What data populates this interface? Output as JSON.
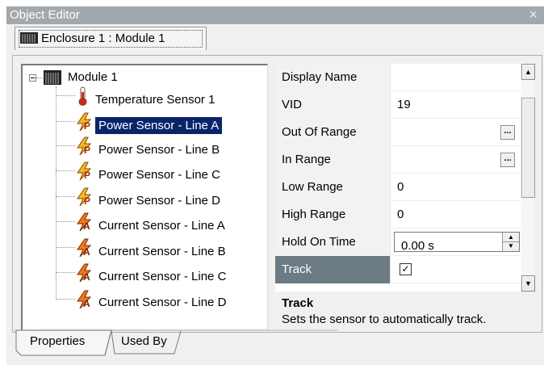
{
  "window": {
    "title": "Object Editor",
    "close_glyph": "×"
  },
  "document_tab": {
    "label": "Enclosure 1 : Module 1",
    "icon": "rack-module-icon"
  },
  "tree": {
    "root": {
      "label": "Module 1",
      "icon": "rack-module-icon",
      "expanded": true
    },
    "items": [
      {
        "label": "Temperature Sensor 1",
        "icon": "thermometer-icon",
        "selected": false
      },
      {
        "label": "Power Sensor - Line A",
        "icon": "power-sensor-icon",
        "selected": true
      },
      {
        "label": "Power Sensor - Line B",
        "icon": "power-sensor-icon",
        "selected": false
      },
      {
        "label": "Power Sensor - Line C",
        "icon": "power-sensor-icon",
        "selected": false
      },
      {
        "label": "Power Sensor - Line D",
        "icon": "power-sensor-icon",
        "selected": false
      },
      {
        "label": "Current Sensor - Line A",
        "icon": "current-sensor-icon",
        "selected": false
      },
      {
        "label": "Current Sensor - Line B",
        "icon": "current-sensor-icon",
        "selected": false
      },
      {
        "label": "Current Sensor - Line C",
        "icon": "current-sensor-icon",
        "selected": false
      },
      {
        "label": "Current Sensor - Line D",
        "icon": "current-sensor-icon",
        "selected": false
      }
    ]
  },
  "properties": [
    {
      "name": "Display Name",
      "value": ""
    },
    {
      "name": "VID",
      "value": "19"
    },
    {
      "name": "Out Of Range",
      "value": "",
      "button": "..."
    },
    {
      "name": "In Range",
      "value": "",
      "button": "..."
    },
    {
      "name": "Low Range",
      "value": "0"
    },
    {
      "name": "High Range",
      "value": "0"
    },
    {
      "name": "Hold On Time",
      "value": "0.00 s",
      "spinner": true
    },
    {
      "name": "Track",
      "value": "✓",
      "checkbox": true,
      "checked": true,
      "selected": true
    }
  ],
  "description": {
    "title": "Track",
    "text": "Sets the sensor to automatically track."
  },
  "bottom_tabs": [
    {
      "label": "Properties",
      "active": true
    },
    {
      "label": "Used By",
      "active": false
    }
  ],
  "colors": {
    "titlebar": "#a2a8ac",
    "selection": "#0a246a",
    "selected_property": "#6b7a83",
    "power_icon": "#f0a020",
    "current_icon": "#e86010"
  }
}
